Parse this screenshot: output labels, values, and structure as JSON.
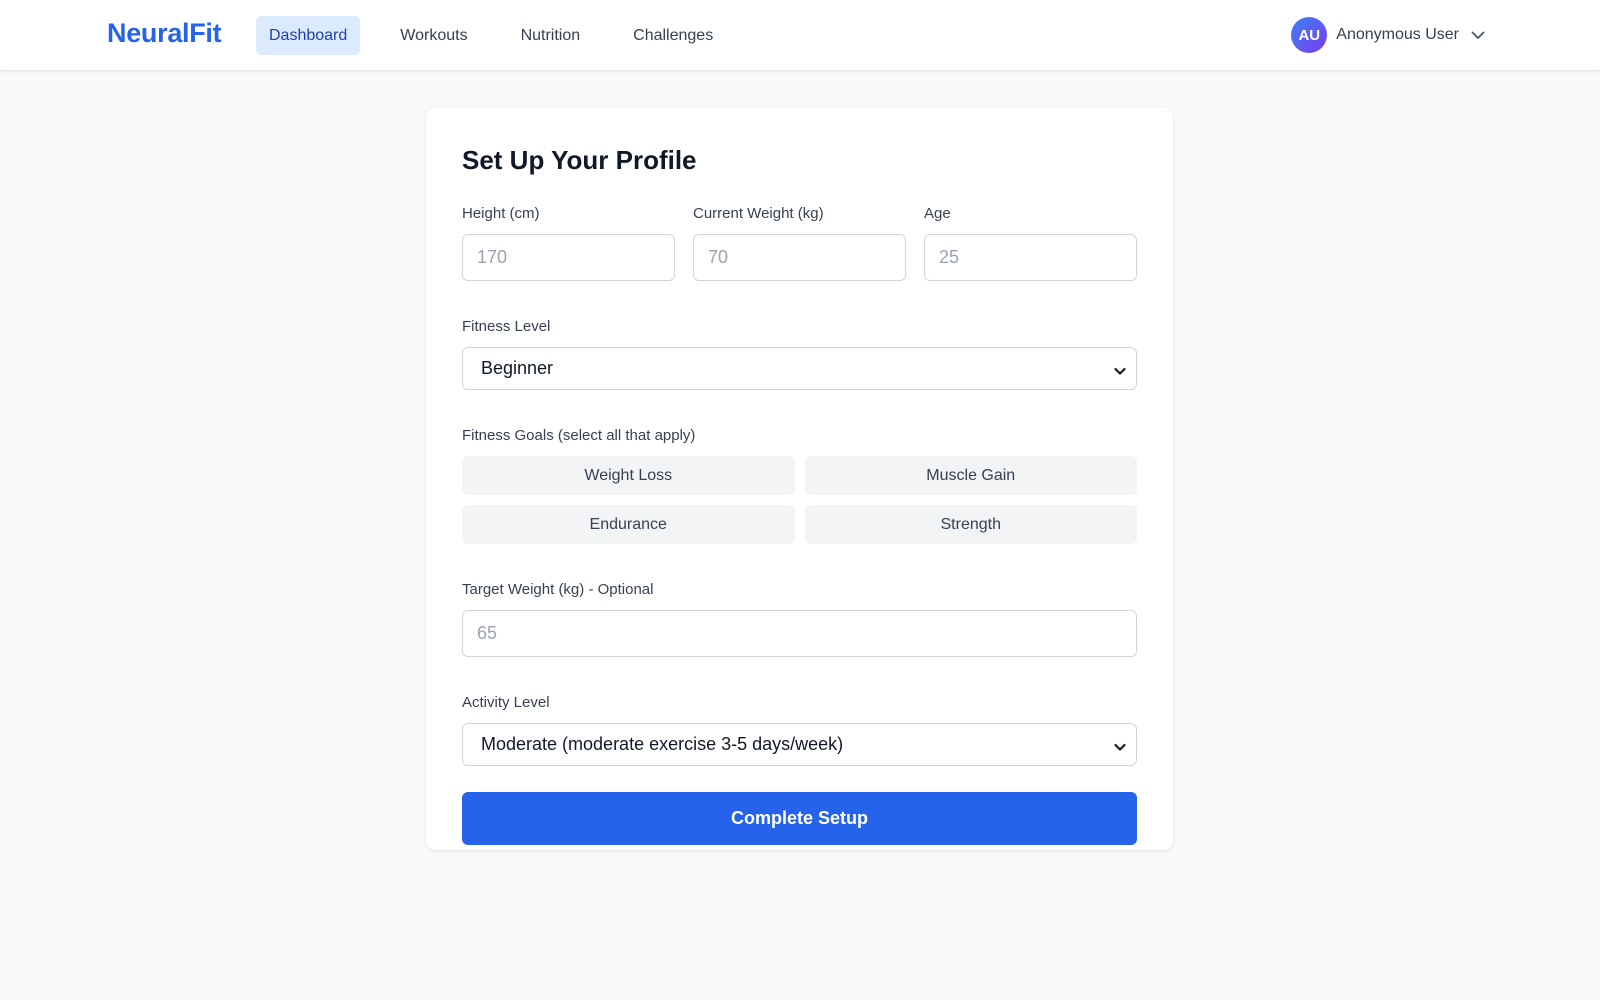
{
  "header": {
    "logo": "NeuralFit",
    "nav": [
      {
        "label": "Dashboard",
        "active": true
      },
      {
        "label": "Workouts",
        "active": false
      },
      {
        "label": "Nutrition",
        "active": false
      },
      {
        "label": "Challenges",
        "active": false
      }
    ],
    "user": {
      "initials": "AU",
      "name": "Anonymous User",
      "icon": "chevron-down-icon"
    }
  },
  "form": {
    "title": "Set Up Your Profile",
    "height": {
      "label": "Height (cm)",
      "placeholder": "170",
      "value": ""
    },
    "weight": {
      "label": "Current Weight (kg)",
      "placeholder": "70",
      "value": ""
    },
    "age": {
      "label": "Age",
      "placeholder": "25",
      "value": ""
    },
    "fitness_level": {
      "label": "Fitness Level",
      "selected": "Beginner"
    },
    "goals": {
      "label": "Fitness Goals (select all that apply)",
      "options": [
        "Weight Loss",
        "Muscle Gain",
        "Endurance",
        "Strength"
      ]
    },
    "target_weight": {
      "label": "Target Weight (kg) - Optional",
      "placeholder": "65",
      "value": ""
    },
    "activity_level": {
      "label": "Activity Level",
      "selected": "Moderate (moderate exercise 3-5 days/week)"
    },
    "submit_label": "Complete Setup"
  },
  "colors": {
    "accent": "#2563eb",
    "nav_active_bg": "#dbeafe",
    "page_bg": "#f9fafb",
    "goal_bg": "#f3f4f6"
  }
}
